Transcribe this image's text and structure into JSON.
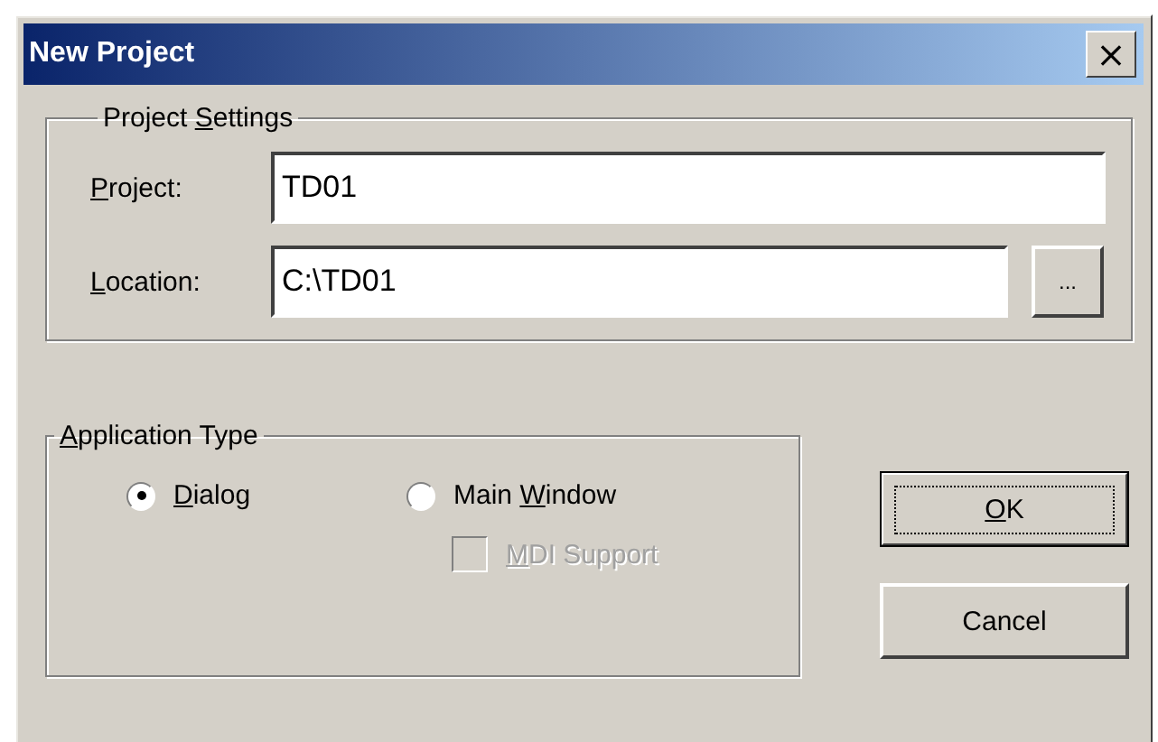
{
  "window": {
    "title": "New Project",
    "close": "×"
  },
  "project_settings": {
    "legend": {
      "pre": "Project ",
      "key": "S",
      "post": "ettings"
    },
    "fields": [
      {
        "kind": "plain",
        "label": {
          "key": "P",
          "post": "roject:"
        },
        "value": "TD01"
      },
      {
        "kind": "browse",
        "label": {
          "key": "L",
          "post": "ocation:"
        },
        "value": "C:\\TD01",
        "button": "..."
      }
    ]
  },
  "application_type": {
    "legend": {
      "key": "A",
      "post": "pplication Type"
    },
    "options": [
      {
        "kind": "radio",
        "label": {
          "key": "D",
          "post": "ialog"
        },
        "selected": true,
        "disabled": false
      },
      {
        "kind": "radio",
        "label": {
          "pre": "Main ",
          "key": "W",
          "post": "indow"
        },
        "selected": false,
        "disabled": false
      },
      {
        "kind": "checkbox",
        "label": {
          "key": "M",
          "post": "DI Support"
        },
        "checked": false,
        "disabled": true
      }
    ]
  },
  "buttons": [
    {
      "label": {
        "key": "O",
        "post": "K"
      },
      "default": true
    },
    {
      "label": {
        "pre": "Cancel"
      },
      "default": false
    }
  ]
}
